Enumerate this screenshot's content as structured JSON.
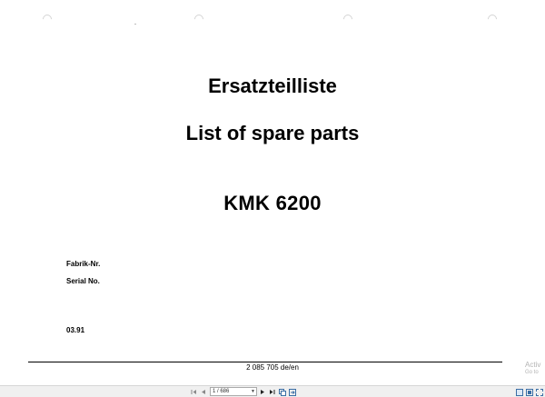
{
  "document": {
    "title_de": "Ersatzteilliste",
    "title_en": "List of spare parts",
    "model": "KMK 6200",
    "fabrik_label": "Fabrik-Nr.",
    "serial_label": "Serial No.",
    "date": "03.91",
    "doc_number": "2 085 705 de/en"
  },
  "watermark": {
    "line1": "Activ",
    "line2": "Go to"
  },
  "toolbar": {
    "page_field": "1 / 686",
    "icons": [
      "first-page-icon",
      "previous-page-icon",
      "next-page-icon",
      "last-page-icon",
      "copy-icon",
      "export-icon",
      "fit-page-icon",
      "fit-width-icon",
      "fullscreen-icon"
    ]
  }
}
